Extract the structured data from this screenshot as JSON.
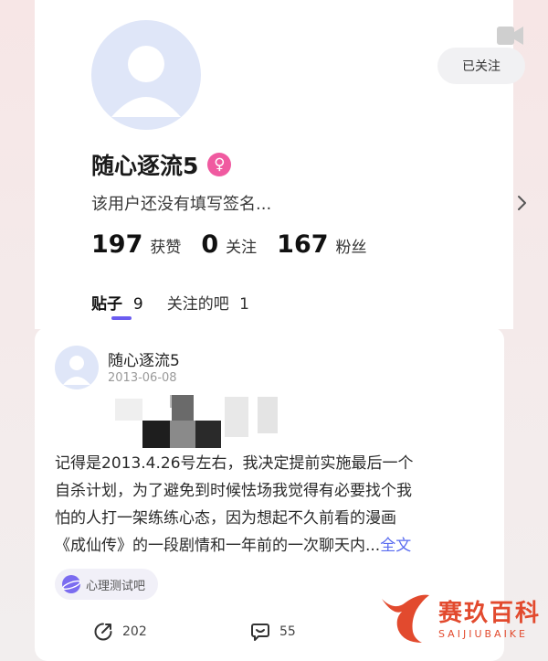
{
  "profile": {
    "follow_label": "已关注",
    "username": "随心逐流5",
    "gender_symbol": "♀",
    "signature": "该用户还没有填写签名...",
    "stats": [
      {
        "value": "197",
        "label": "获赞"
      },
      {
        "value": "0",
        "label": "关注"
      },
      {
        "value": "167",
        "label": "粉丝"
      }
    ],
    "tabs": [
      {
        "label": "贴子",
        "count": "9"
      },
      {
        "label": "关注的吧",
        "count": "1"
      }
    ]
  },
  "post": {
    "author": "随心逐流5",
    "date": "2013-06-08",
    "text_lines": [
      "记得是2013.4.26号左右，我决定提前实施最后一个",
      "自杀计划，为了避免到时候怯场我觉得有必要找个我",
      "怕的人打一架练练心态，因为想起不久前看的漫画",
      "《成仙传》的一段剧情和一年前的一次聊天内..."
    ],
    "more_label": "全文",
    "topic": "心理测试吧",
    "share_count": "202",
    "comment_count": "55"
  },
  "watermark": {
    "cn": "赛玖百科",
    "en": "SAIJIUBAIKE"
  },
  "colors": {
    "accent": "#6b5cf0",
    "link": "#5a6cf0",
    "gender": "#f05aa0",
    "watermark": "#e24a2e"
  }
}
